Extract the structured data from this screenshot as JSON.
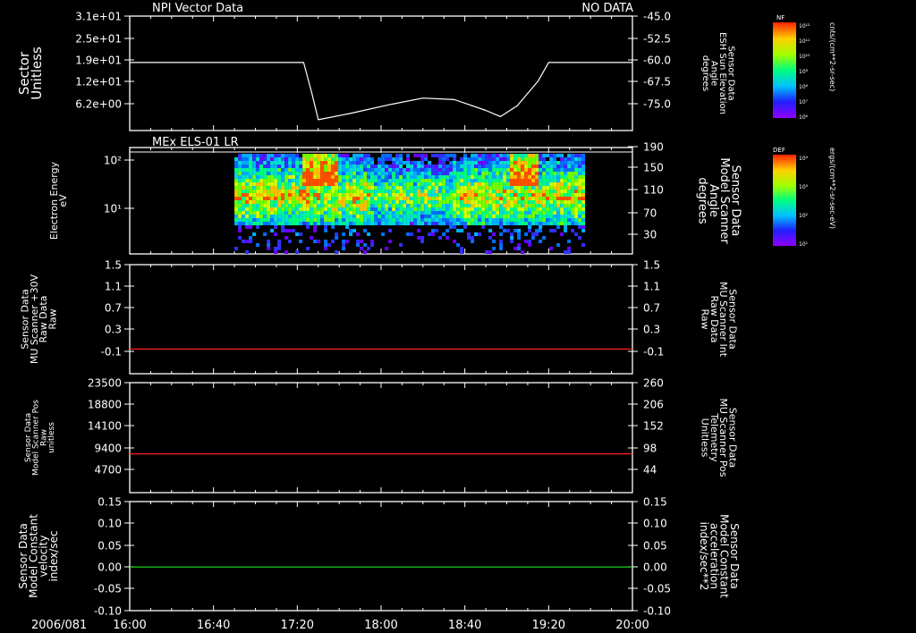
{
  "header": {
    "left": "NPI Vector Data",
    "right": "NO DATA"
  },
  "x_axis": {
    "date": "2006/081",
    "ticks": [
      "16:00",
      "16:40",
      "17:20",
      "18:00",
      "18:40",
      "19:20",
      "20:00"
    ]
  },
  "colorbars": [
    {
      "tag": "NF",
      "top_tick": "10¹²",
      "bottom_tick": "10⁶",
      "ticks": [
        "10¹²",
        "10¹¹",
        "10¹⁰",
        "10⁹",
        "10⁸",
        "10⁷",
        "10⁶"
      ],
      "unit": "cnts/(cm**2-sr-sec)"
    },
    {
      "tag": "DEF",
      "top_tick": "10⁴",
      "bottom_tick": "10¹",
      "ticks": [
        "10⁴",
        "10³",
        "10²",
        "10¹"
      ],
      "unit": "ergs/(cm**2-sr-sec-eV)"
    }
  ],
  "colors": {
    "curve": "#ffffff",
    "red_line": "#ff2020",
    "green_line": "#20e020",
    "red_label": "#ff3030",
    "green_label": "#30ff30"
  },
  "chart_data": [
    {
      "type": "line",
      "left_label": [
        "Sector",
        "Unitless"
      ],
      "right_label": [
        "Sensor Data",
        "ESH Sun Elevation",
        "Angle",
        "degrees"
      ],
      "left_ticks": [
        "3.1e+01",
        "2.5e+01",
        "1.9e+01",
        "1.2e+01",
        "6.2e+00"
      ],
      "right_ticks": [
        "-45.0",
        "-52.5",
        "-60.0",
        "-67.5",
        "-75.0"
      ],
      "ylim": [
        -45,
        -82
      ],
      "series": [
        {
          "x": [
            "16:00",
            "17:00",
            "17:23",
            "17:27",
            "17:30",
            "17:45",
            "18:05",
            "18:20",
            "18:35",
            "18:50",
            "18:57",
            "19:05",
            "19:15",
            "19:20",
            "20:00"
          ],
          "y": [
            -60,
            -60,
            -60,
            -70,
            -78.5,
            -76.5,
            -73.5,
            -71.5,
            -72,
            -75.5,
            -77.5,
            -74,
            -66,
            -60,
            -60
          ]
        }
      ]
    },
    {
      "type": "heatmap",
      "title": "MEx ELS-01 LR",
      "left_label": [
        "Electron Energy",
        "eV"
      ],
      "right_label": [
        "Sensor Data",
        "Model Scanner",
        "Angle",
        "degrees"
      ],
      "left_ticks": [
        "10²",
        "10¹"
      ],
      "right_ticks": [
        "190",
        "150",
        "110",
        "70",
        "30"
      ],
      "x_range": [
        "16:50",
        "19:37"
      ]
    },
    {
      "type": "line",
      "left_label": [
        "Sensor Data",
        "MU Scanner +30V",
        "Raw Data",
        "Raw"
      ],
      "right_label": [
        "Sensor Data",
        "MU Scanner Int",
        "Raw Data",
        "Raw"
      ],
      "left_ticks": [
        "1.5",
        "1.1",
        "0.7",
        "0.3",
        "-0.1"
      ],
      "right_ticks": [
        "1.5",
        "1.1",
        "0.7",
        "0.3",
        "-0.1"
      ],
      "ylim": [
        1.5,
        -0.4
      ],
      "series": [
        {
          "x": [
            "16:00",
            "20:00"
          ],
          "y": [
            0.03,
            0.03
          ]
        }
      ]
    },
    {
      "type": "line",
      "left_label": [
        "Sensor Data",
        "Model Scanner Pos",
        "Raw",
        "unitless"
      ],
      "right_label": [
        "Sensor Data",
        "MU Scanner Pos",
        "Telemetry",
        "Unitless"
      ],
      "left_ticks": [
        "23500",
        "18800",
        "14100",
        "9400",
        "4700"
      ],
      "right_ticks": [
        "260",
        "206",
        "152",
        "98",
        "44"
      ],
      "ylim": [
        23500,
        0
      ],
      "series": [
        {
          "x": [
            "16:00",
            "20:00"
          ],
          "y": [
            8300,
            8300
          ]
        }
      ]
    },
    {
      "type": "line",
      "left_label": [
        "Sensor Data",
        "Model Constant",
        "velocity",
        "index/sec"
      ],
      "right_label": [
        "Sensor Data",
        "Model Constant",
        "acceleration",
        "index/sec**2"
      ],
      "left_ticks": [
        "0.15",
        "0.10",
        "0.05",
        "0.00",
        "-0.05",
        "-0.10"
      ],
      "right_ticks": [
        "0.15",
        "0.10",
        "0.05",
        "0.00",
        "-0.05",
        "-0.10"
      ],
      "ylim": [
        0.15,
        -0.1
      ],
      "series": [
        {
          "x": [
            "16:00",
            "20:00"
          ],
          "y": [
            0.0,
            0.0
          ]
        }
      ]
    }
  ]
}
